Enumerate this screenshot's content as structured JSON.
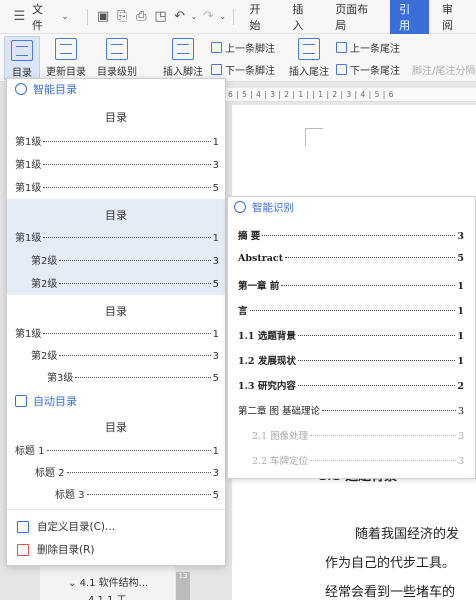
{
  "toolbar": {
    "file_label": "文件",
    "tabs": [
      "开始",
      "插入",
      "页面布局",
      "引用",
      "审阅"
    ],
    "active_tab": "引用"
  },
  "ribbon": {
    "toc_label": "目录",
    "update_toc_label": "更新目录",
    "toc_level_label": "目录级别",
    "insert_footnote_label": "插入脚注",
    "prev_footnote_label": "上一条脚注",
    "next_footnote_label": "下一条脚注",
    "insert_endnote_label": "插入尾注",
    "prev_endnote_label": "上一条尾注",
    "next_endnote_label": "下一条尾注",
    "footnote_endnote_sep_label": "脚注/尾注分隔"
  },
  "ruler": {
    "marks": "6 | 5 | 4 | 3 | 2 | 1 |   | 1 | 2 | 3 | 4 | 5 | 6"
  },
  "dropdown": {
    "smart_toc_header": "智能目录",
    "options": [
      {
        "title": "目录",
        "entries": [
          {
            "text": "第1级",
            "page": "1"
          },
          {
            "text": "第1级",
            "page": "3"
          },
          {
            "text": "第1级",
            "page": "5"
          }
        ]
      },
      {
        "title": "目录",
        "entries": [
          {
            "text": "第1级",
            "page": "1"
          },
          {
            "text": "第2级",
            "page": "3"
          },
          {
            "text": "第2级",
            "page": "5"
          }
        ]
      },
      {
        "title": "目录",
        "entries": [
          {
            "text": "第1级",
            "page": "1"
          },
          {
            "text": "第2级",
            "page": "3"
          },
          {
            "text": "第3级",
            "page": "5"
          }
        ]
      }
    ],
    "auto_toc_header": "自动目录",
    "auto_toc": {
      "title": "目录",
      "entries": [
        {
          "text": "标题 1",
          "page": "1"
        },
        {
          "text": "标题 2",
          "page": "3"
        },
        {
          "text": "标题 3",
          "page": "5"
        }
      ]
    },
    "custom_toc_label": "自定义目录(C)...",
    "delete_toc_label": "删除目录(R)"
  },
  "smart_recognize": {
    "header": "智能识别",
    "entries": [
      {
        "text": "摘  要",
        "page": "3"
      },
      {
        "text": "Abstract",
        "page": "5"
      },
      {
        "text": "第一章 前",
        "page": "1"
      },
      {
        "text": "言",
        "page": "1"
      },
      {
        "text": "1.1 选题背景",
        "page": "1"
      },
      {
        "text": "1.2 发展现状",
        "page": "1"
      },
      {
        "text": "1.3 研究内容",
        "page": "2"
      },
      {
        "text": "第二章 图    基础理论",
        "page": "3"
      },
      {
        "text": "2.1 图像处理",
        "page": "3"
      },
      {
        "text": "2.2 车牌定位",
        "page": "3"
      }
    ]
  },
  "document": {
    "heading_partial": "1.1  选题背景",
    "para_line1": "随着我国经济的发",
    "para_line2": "作为自己的代步工具。",
    "para_line3": "经常会看到一些堵车的"
  },
  "navigation": {
    "item": "4.1 软件结构...",
    "sub_item": "4.1.1 工",
    "scroll_label": "13"
  }
}
